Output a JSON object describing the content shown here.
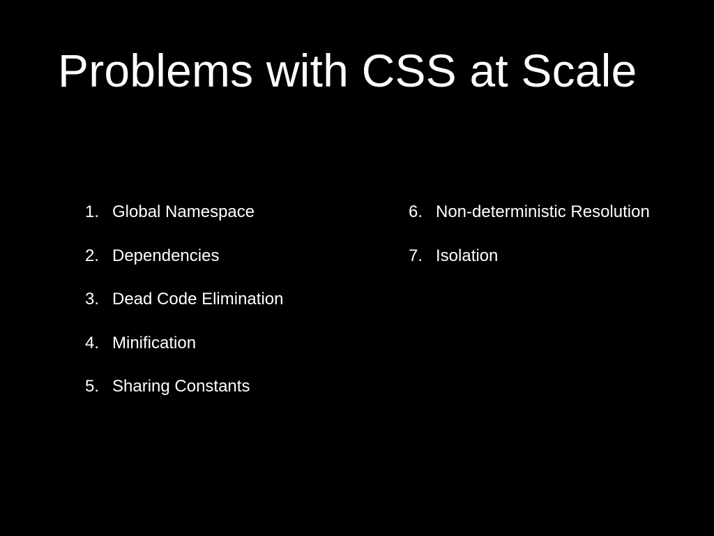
{
  "slide": {
    "title": "Problems with CSS at Scale",
    "left_items": [
      {
        "num": "1.",
        "text": "Global Namespace"
      },
      {
        "num": "2.",
        "text": "Dependencies"
      },
      {
        "num": "3.",
        "text": "Dead Code Elimination"
      },
      {
        "num": "4.",
        "text": "Minification"
      },
      {
        "num": "5.",
        "text": "Sharing Constants"
      }
    ],
    "right_items": [
      {
        "num": "6.",
        "text": "Non-deterministic Resolution"
      },
      {
        "num": "7.",
        "text": "Isolation"
      }
    ]
  },
  "colors": {
    "background": "#000000",
    "text": "#ffffff"
  }
}
